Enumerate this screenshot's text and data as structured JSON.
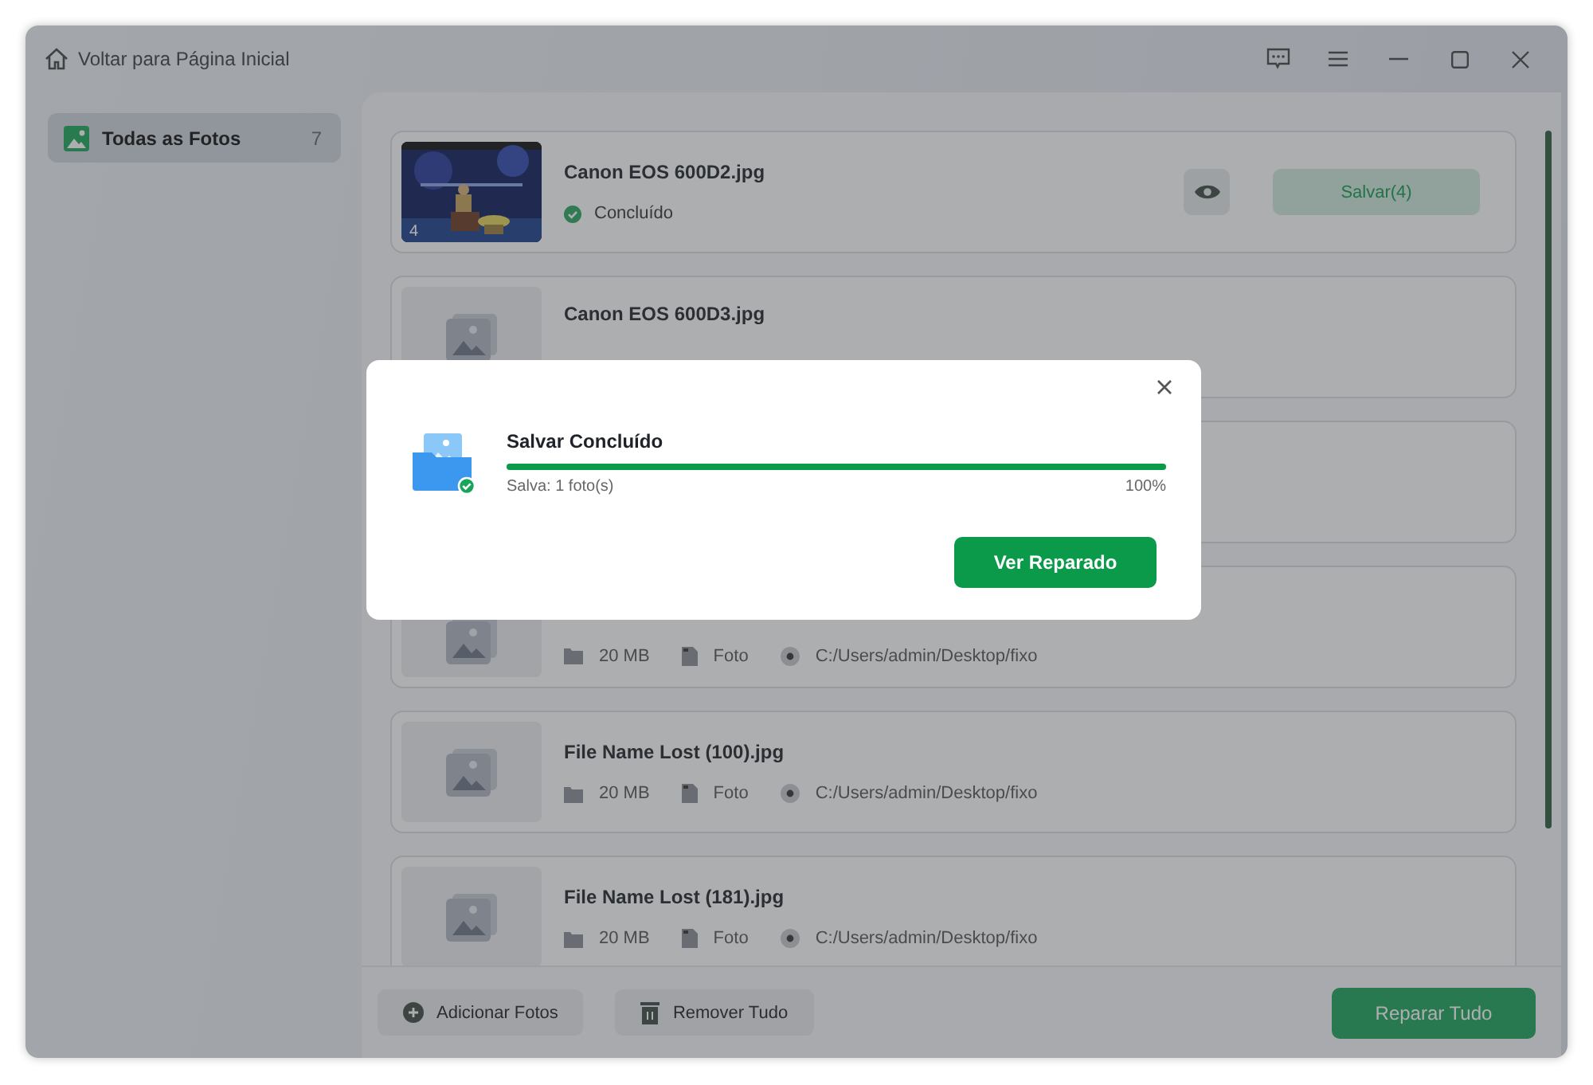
{
  "window": {
    "back_link": "Voltar para Página Inicial"
  },
  "sidebar": {
    "items": [
      {
        "label": "Todas as Fotos",
        "count": "7",
        "selected": true
      }
    ]
  },
  "files": [
    {
      "kind": "done",
      "name": "Canon EOS 600D2.jpg",
      "badge": "4",
      "status": "Concluído",
      "save_button": "Salvar(4)"
    },
    {
      "kind": "name_only",
      "name": "Canon EOS 600D3.jpg"
    },
    {
      "kind": "covered"
    },
    {
      "kind": "meta_only",
      "size": "20 MB",
      "type": "Foto",
      "path": "C:/Users/admin/Desktop/fixo"
    },
    {
      "kind": "file",
      "name": "File Name Lost (100).jpg",
      "size": "20 MB",
      "type": "Foto",
      "path": "C:/Users/admin/Desktop/fixo"
    },
    {
      "kind": "file",
      "name": "File Name Lost (181).jpg",
      "size": "20 MB",
      "type": "Foto",
      "path": "C:/Users/admin/Desktop/fixo"
    }
  ],
  "bottom_bar": {
    "add_button": "Adicionar Fotos",
    "remove_button": "Remover Tudo",
    "repair_button": "Reparar Tudo"
  },
  "dialog": {
    "title": "Salvar Concluído",
    "level": 1,
    "detail": "Salva: 1 foto(s)",
    "percent": "100%",
    "button": "Ver Reparado"
  }
}
